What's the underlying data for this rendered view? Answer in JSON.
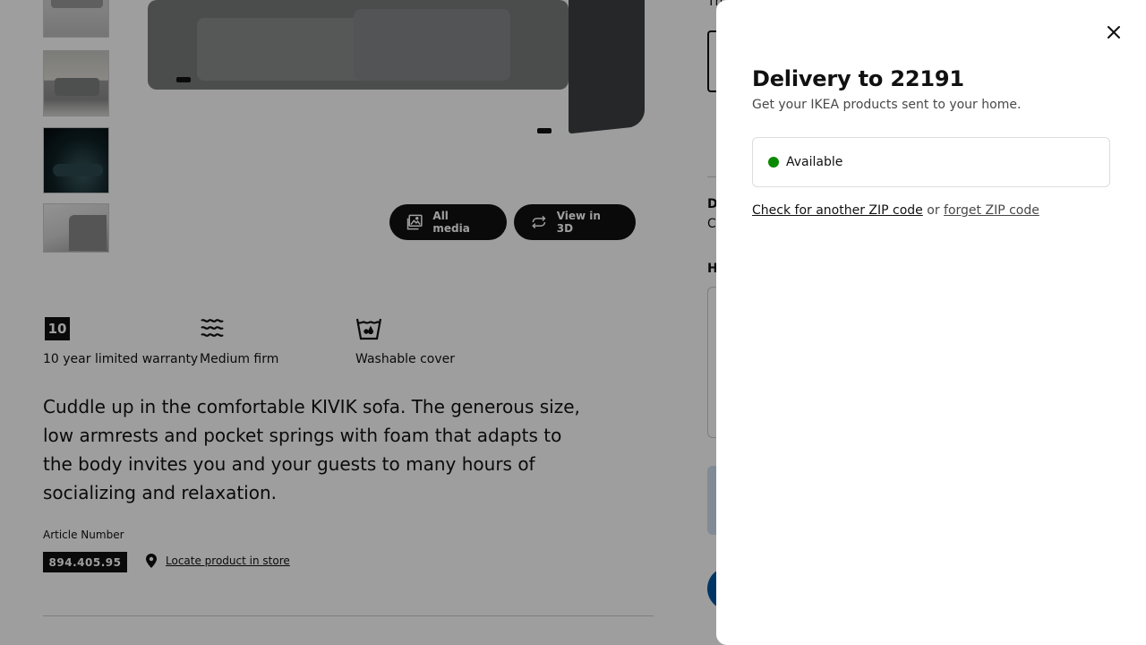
{
  "background": {
    "media_buttons": {
      "all_media": "All media",
      "view_3d": "View in 3D"
    },
    "features": [
      {
        "icon": "warranty-10-icon",
        "badge": "10",
        "label": "10 year limited warranty"
      },
      {
        "icon": "medium-firm-icon",
        "label": "Medium firm"
      },
      {
        "icon": "washable-cover-icon",
        "label": "Washable cover"
      }
    ],
    "description": "Cuddle up in the comfortable KIVIK sofa. The generous size, low armrests and pocket springs with foam that adapts to the body invites you and your guests to many hours of socializing and relaxation.",
    "article_label": "Article Number",
    "article_number": "894.405.95",
    "locate_link": "Locate product in store",
    "right_fragments": {
      "t1": "Th",
      "t2": "D",
      "t3": "C",
      "t4": "H"
    }
  },
  "drawer": {
    "title": "Delivery to 22191",
    "subtitle": "Get your IKEA products sent to your home.",
    "availability": "Available",
    "check_link": "Check for another ZIP code",
    "or_text": " or ",
    "forget_link": "forget ZIP code"
  },
  "colors": {
    "available_dot": "#0a8a00",
    "ikea_blue": "#0058a3"
  }
}
